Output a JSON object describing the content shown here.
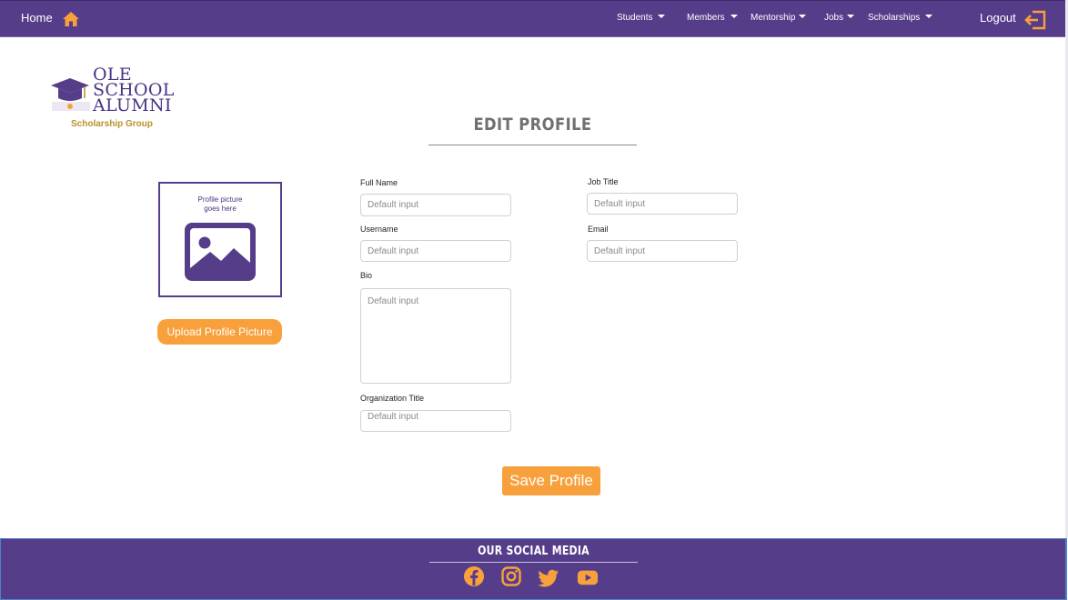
{
  "nav": {
    "home_label": "Home",
    "items": [
      {
        "label": "Students"
      },
      {
        "label": "Members"
      },
      {
        "label": "Mentorship"
      },
      {
        "label": "Jobs"
      },
      {
        "label": "Scholarships"
      }
    ],
    "logout_label": "Logout"
  },
  "logo": {
    "line1": "OLE",
    "line2": "SCHOOL",
    "line3": "ALUMNI",
    "subtitle": "Scholarship Group"
  },
  "page": {
    "title": "EDIT PROFILE"
  },
  "avatar": {
    "caption_line1": "Profile picture",
    "caption_line2": "goes here",
    "upload_label": "Upload Profile Picture"
  },
  "form": {
    "full_name": {
      "label": "Full Name",
      "value": "",
      "placeholder": "Default input"
    },
    "username": {
      "label": "Username",
      "value": "",
      "placeholder": "Default input"
    },
    "bio": {
      "label": "Bio",
      "value": "",
      "placeholder": "Default input"
    },
    "organization_title": {
      "label": "Organization Title",
      "value": "",
      "placeholder": "Default input"
    },
    "job_title": {
      "label": "Job Title",
      "value": "",
      "placeholder": "Default input"
    },
    "email": {
      "label": "Email",
      "value": "",
      "placeholder": "Default input"
    },
    "save_label": "Save Profile"
  },
  "footer": {
    "title": "OUR SOCIAL MEDIA",
    "icons": [
      "facebook-icon",
      "instagram-icon",
      "twitter-icon",
      "youtube-icon"
    ]
  },
  "colors": {
    "brand_purple": "#563d8a",
    "accent_orange": "#f8a03b",
    "logo_gold": "#b8902c",
    "footer_border": "#4d83c6"
  }
}
